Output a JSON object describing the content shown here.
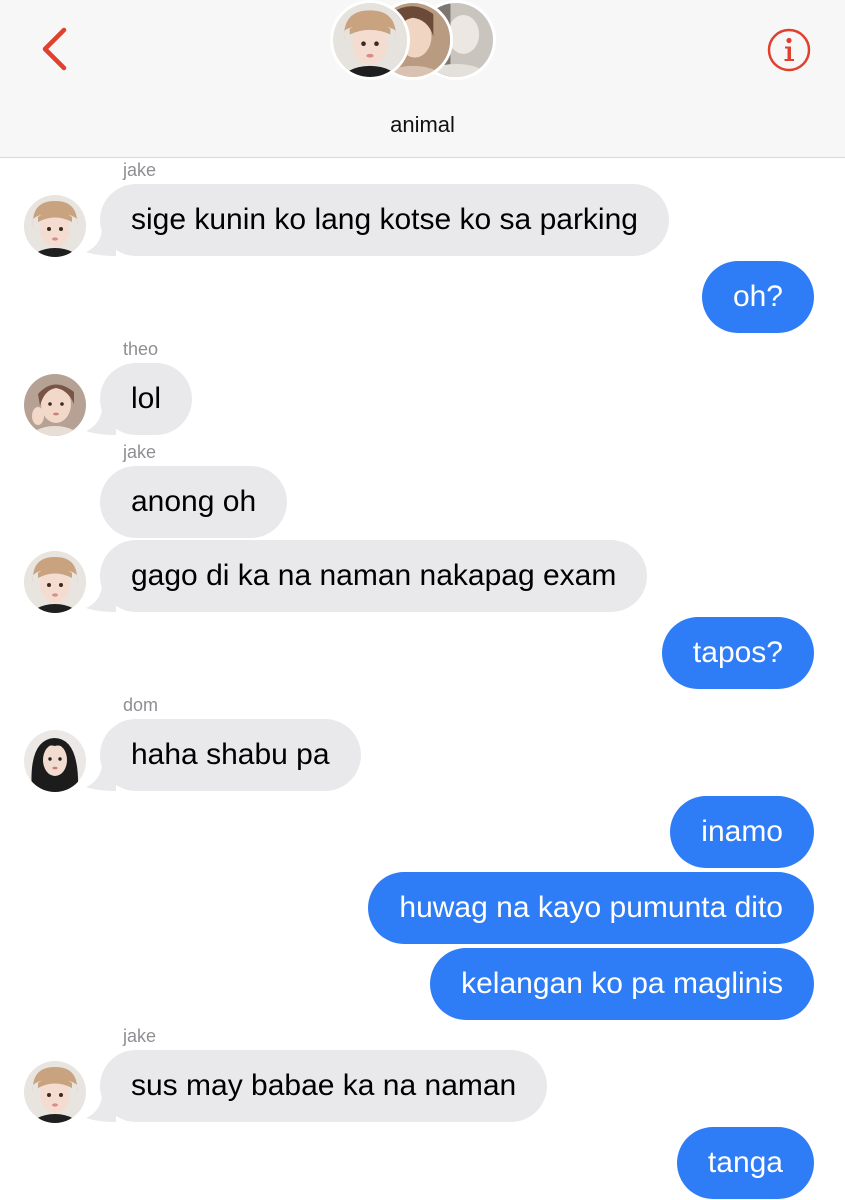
{
  "header": {
    "group_name": "animal",
    "back_icon": "chevron-left-icon",
    "info_icon": "info-icon",
    "accent_color": "#e0412f"
  },
  "colors": {
    "incoming_bubble": "#e9e9eb",
    "outgoing_bubble": "#2f7df6",
    "sender_name": "#8e8e93"
  },
  "messages": [
    {
      "sender": "jake",
      "text": "sige kunin ko lang kotse ko sa parking"
    },
    {
      "sender": "me",
      "text": "oh?"
    },
    {
      "sender": "theo",
      "text": "lol"
    },
    {
      "sender": "jake",
      "text": "anong oh"
    },
    {
      "sender": "jake",
      "text": "gago di ka na naman nakapag exam"
    },
    {
      "sender": "me",
      "text": "tapos?"
    },
    {
      "sender": "dom",
      "text": "haha shabu pa"
    },
    {
      "sender": "me",
      "text": "inamo"
    },
    {
      "sender": "me",
      "text": "huwag na kayo pumunta dito"
    },
    {
      "sender": "me",
      "text": "kelangan ko pa maglinis"
    },
    {
      "sender": "jake",
      "text": "sus may babae ka na naman"
    },
    {
      "sender": "me",
      "text": "tanga"
    }
  ]
}
